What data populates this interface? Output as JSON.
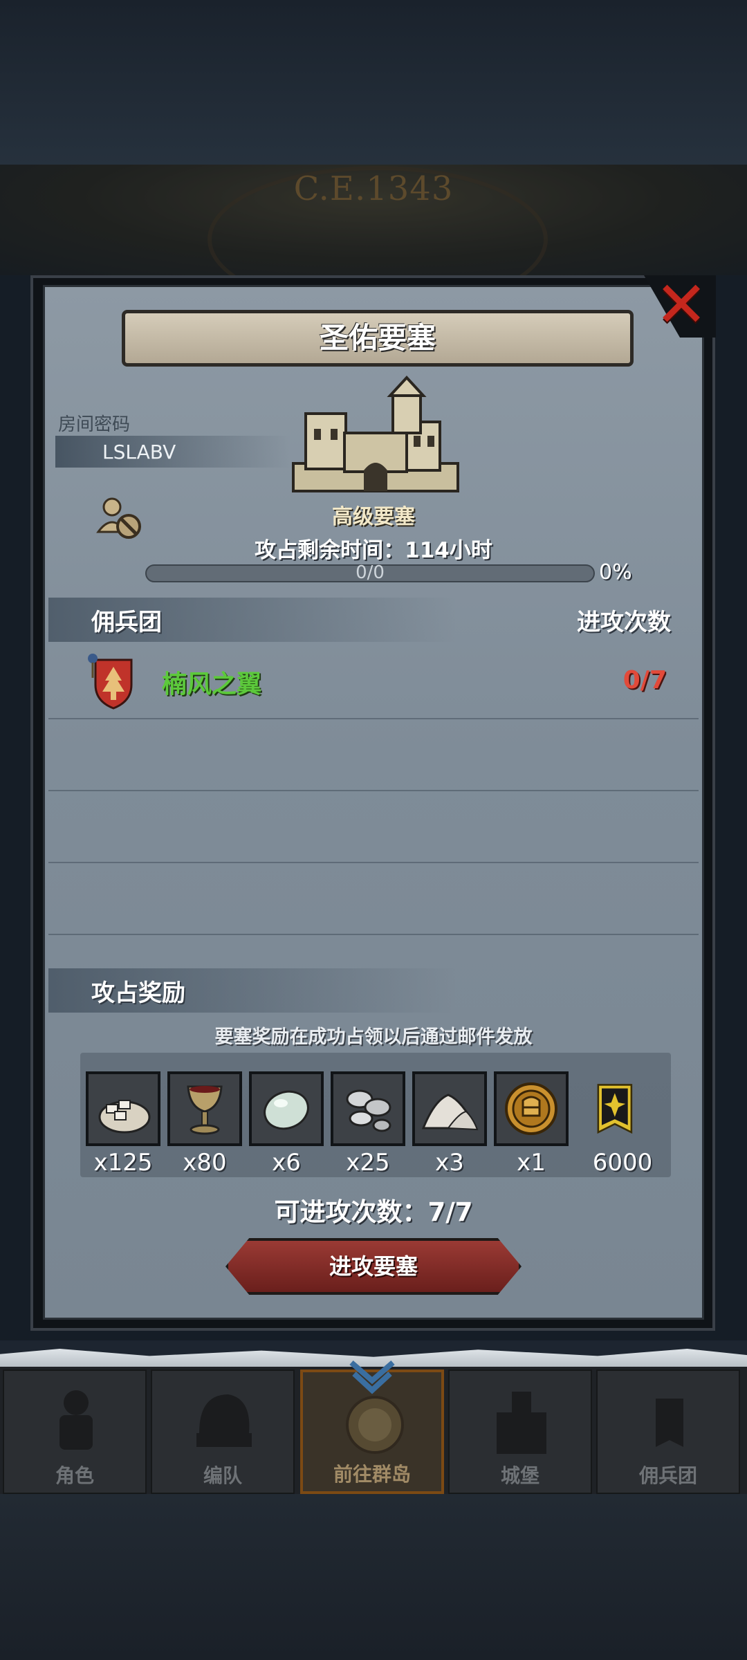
{
  "header": {
    "era": "C.E.1343"
  },
  "dialog": {
    "title": "圣佑要塞",
    "room_label": "房间密码",
    "room_code": "LSLABV",
    "fortress_level": "高级要塞",
    "time_remaining": "攻占剩余时间：114小时",
    "progress": {
      "text": "0/0",
      "percent_label": "0%",
      "fraction": 0
    }
  },
  "mercenaries": {
    "title": "佣兵团",
    "count_header": "进攻次数",
    "rows": [
      {
        "name": "楠风之翼",
        "count": "0/7"
      }
    ]
  },
  "rewards": {
    "title": "攻占奖励",
    "note": "要塞奖励在成功占领以后通过邮件发放",
    "items": [
      {
        "icon": "bread-sack-icon",
        "qty": "x125"
      },
      {
        "icon": "goblet-icon",
        "qty": "x80"
      },
      {
        "icon": "gem-stone-icon",
        "qty": "x6"
      },
      {
        "icon": "silver-ore-icon",
        "qty": "x25"
      },
      {
        "icon": "salt-pile-icon",
        "qty": "x3"
      },
      {
        "icon": "knight-medal-icon",
        "qty": "x1"
      },
      {
        "icon": "banner-emblem-icon",
        "qty": "6000"
      }
    ]
  },
  "attempts_text": "可进攻次数：7/7",
  "attack_button": "进攻要塞",
  "nav": {
    "items": [
      {
        "label": "角色",
        "icon": "knight-icon"
      },
      {
        "label": "编队",
        "icon": "helmet-icon"
      },
      {
        "label": "前往群岛",
        "icon": "globe-compass-icon"
      },
      {
        "label": "城堡",
        "icon": "castle-icon"
      },
      {
        "label": "佣兵团",
        "icon": "mercenary-icon"
      }
    ],
    "active_index": 2
  },
  "colors": {
    "guild_name": "#5cc93b",
    "count_red": "#e24a3a",
    "close_red": "#c4271d",
    "button_red": "#8a302b"
  }
}
